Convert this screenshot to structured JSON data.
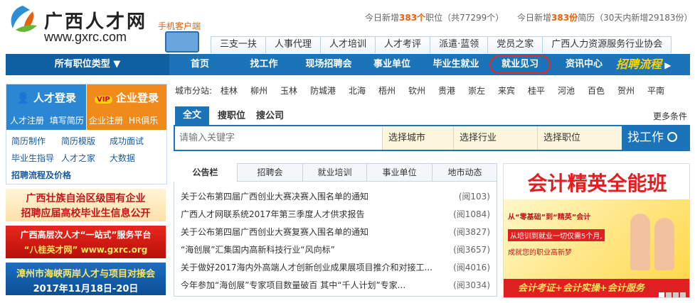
{
  "header": {
    "logo_text": "广西人才网",
    "logo_url": "www.gxrc.com",
    "mobile_label": "手机客户端",
    "stat_jobs_prefix": "今日新增",
    "stat_jobs_count": "383个",
    "stat_jobs_suffix": "职位（共77299个）",
    "stat_resumes_prefix": "今日新增",
    "stat_resumes_count": "383份",
    "stat_resumes_suffix": "简历（30天内新增29183份）"
  },
  "top_tabs": [
    "三支一扶",
    "人事代理",
    "人才培训",
    "人才考评",
    "派遣·蓝领",
    "党员之家",
    "广西人力资源服务行业协会"
  ],
  "nav": {
    "category": "所有职位类型",
    "items": [
      "首页",
      "找工作",
      "现场招聘会",
      "事业单位",
      "毕业生就业",
      "就业见习",
      "资讯中心"
    ],
    "process": "招聘流程"
  },
  "login": {
    "talent_login": "人才登录",
    "talent_register": "人才注册",
    "fill_resume": "填写简历",
    "company_login": "企业登录",
    "vip": "VIP",
    "company_register": "企业注册",
    "hr_club": "HR俱乐部"
  },
  "side_links": [
    "简历制作",
    "简历模版",
    "成功面试",
    "毕业生指导",
    "人才之家",
    "大数据",
    "招聘流程及价格"
  ],
  "banners": [
    {
      "line1": "广西壮族自治区级国有企业",
      "line2": "招聘应届高校毕业生信息公开"
    },
    {
      "line1": "广西高层次人才“一站式”服务平台",
      "line2": "“八桂英才网” www.gxrc.org"
    },
    {
      "line1": "漳州市海峡两岸人才与项目对接会",
      "line2": "2017年11月18日-20日"
    }
  ],
  "cities": {
    "label": "城市分站:",
    "list": [
      "桂林",
      "柳州",
      "玉林",
      "防城港",
      "北海",
      "梧州",
      "钦州",
      "贵港",
      "崇左",
      "来宾",
      "桂平",
      "河池",
      "百色",
      "贺州",
      "平南"
    ]
  },
  "search": {
    "tabs": [
      "全文",
      "搜职位",
      "搜公司"
    ],
    "more": "更多条件",
    "placeholder": "请输入关键字",
    "city": "选择城市",
    "industry": "选择行业",
    "position": "选择职位",
    "button": "找工作"
  },
  "notice": {
    "tabs": [
      "公告栏",
      "招聘会",
      "就业培训",
      "事业单位",
      "地市动态"
    ],
    "items": [
      {
        "title": "关于公布第四届广西创业大赛决赛入围名单的通知",
        "reads": "(阅103)"
      },
      {
        "title": "广西人才网联系统2017年第三季度人才供求报告",
        "reads": "(阅1084)"
      },
      {
        "title": "关于公布第四届广西创业大赛复赛入围名单的通知",
        "reads": "(阅3827)"
      },
      {
        "title": "“海创展”汇集国内高新科技行业“风向标”",
        "reads": "(阅3657)"
      },
      {
        "title": "关于做好2017海内外高端人才创新创业成果展项目推介和对接工...",
        "reads": "(阅4016)"
      },
      {
        "title": "今年参加“海创展”专家项目数量破百 其中“千人计划”专家...",
        "reads": "(阅3034)"
      }
    ]
  },
  "ad": {
    "title": "会计精英全能班",
    "line1": "从“零基础”到“精英”会计",
    "line2": "从培训到就业一切仅需5个月,",
    "line3": "成就您的职业高新梦",
    "footer": "会计考证+会计实操+会计服务"
  }
}
